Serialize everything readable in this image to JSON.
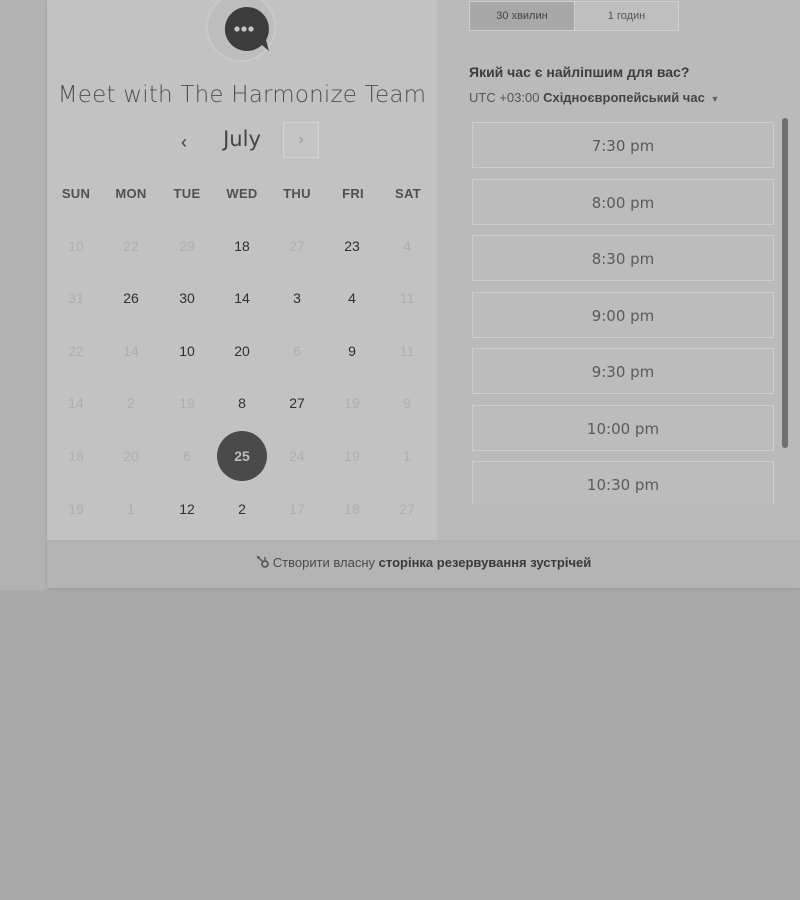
{
  "header": {
    "title": "Meet with The Harmonize Team",
    "month": "July",
    "prev_glyph": "‹",
    "next_glyph": "›"
  },
  "calendar": {
    "weekdays": [
      "SUN",
      "MON",
      "TUE",
      "WED",
      "THU",
      "FRI",
      "SAT"
    ],
    "weeks": [
      [
        {
          "d": "10",
          "on": false
        },
        {
          "d": "22",
          "on": false
        },
        {
          "d": "29",
          "on": false
        },
        {
          "d": "18",
          "on": true
        },
        {
          "d": "27",
          "on": false
        },
        {
          "d": "23",
          "on": true
        },
        {
          "d": "4",
          "on": false
        }
      ],
      [
        {
          "d": "31",
          "on": false
        },
        {
          "d": "26",
          "on": true
        },
        {
          "d": "30",
          "on": true
        },
        {
          "d": "14",
          "on": true
        },
        {
          "d": "3",
          "on": true
        },
        {
          "d": "4",
          "on": true
        },
        {
          "d": "11",
          "on": false
        }
      ],
      [
        {
          "d": "22",
          "on": false
        },
        {
          "d": "14",
          "on": false
        },
        {
          "d": "10",
          "on": true
        },
        {
          "d": "20",
          "on": true
        },
        {
          "d": "6",
          "on": false
        },
        {
          "d": "9",
          "on": true
        },
        {
          "d": "11",
          "on": false
        }
      ],
      [
        {
          "d": "14",
          "on": false
        },
        {
          "d": "2",
          "on": false
        },
        {
          "d": "19",
          "on": false
        },
        {
          "d": "8",
          "on": true
        },
        {
          "d": "27",
          "on": true
        },
        {
          "d": "19",
          "on": false
        },
        {
          "d": "9",
          "on": false
        }
      ],
      [
        {
          "d": "18",
          "on": false
        },
        {
          "d": "20",
          "on": false
        },
        {
          "d": "6",
          "on": false
        },
        {
          "d": "25",
          "on": true,
          "selected": true
        },
        {
          "d": "24",
          "on": false
        },
        {
          "d": "19",
          "on": false
        },
        {
          "d": "1",
          "on": false
        }
      ],
      [
        {
          "d": "19",
          "on": false
        },
        {
          "d": "1",
          "on": false
        },
        {
          "d": "12",
          "on": true
        },
        {
          "d": "2",
          "on": true
        },
        {
          "d": "17",
          "on": false
        },
        {
          "d": "18",
          "on": false
        },
        {
          "d": "27",
          "on": false
        }
      ]
    ]
  },
  "durations": {
    "option1": "30 хвилин",
    "option2": "1 годин"
  },
  "times": {
    "question": "Який час є найліпшим для вас?",
    "tz_offset": "UTC +03:00",
    "tz_name": "Східноєвропейський час",
    "slots": [
      "7:30 pm",
      "8:00 pm",
      "8:30 pm",
      "9:00 pm",
      "9:30 pm",
      "10:00 pm",
      "10:30 pm"
    ]
  },
  "footer": {
    "prefix": "Створити власну",
    "link": "сторінка резервування зустрічей"
  },
  "colors": {
    "selected_day": "#4a4a4a",
    "overlay": "#a9a9a9"
  },
  "icons": {
    "avatar": "chat-bubble-icon",
    "footer": "hubspot-sprocket-icon",
    "tz_dropdown": "caret-down-icon"
  }
}
